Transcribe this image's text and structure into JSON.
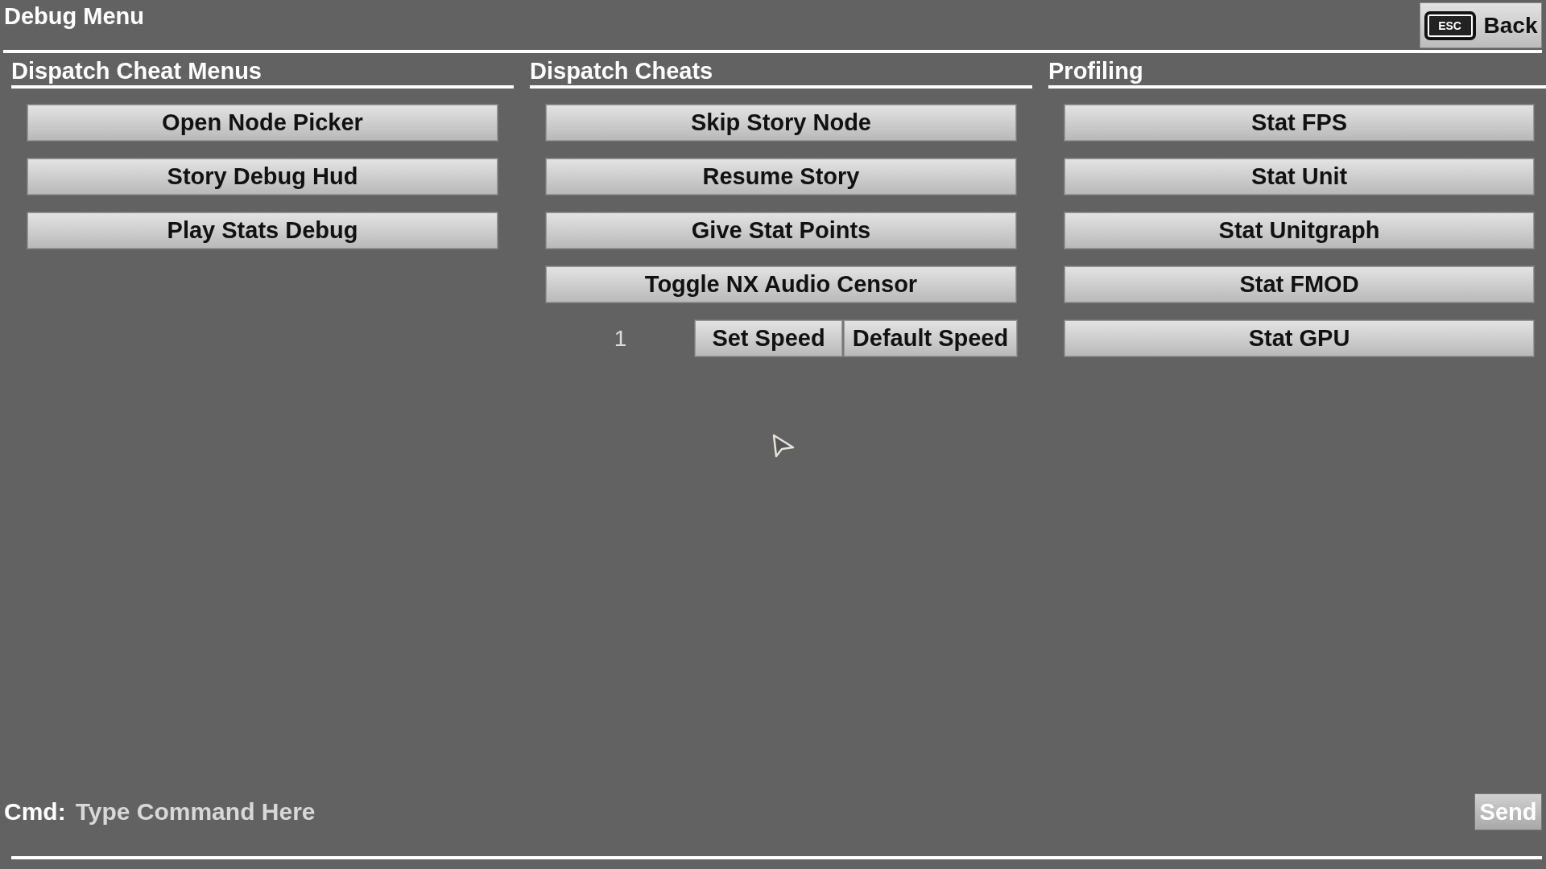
{
  "window": {
    "title": "Debug Menu"
  },
  "back_button": {
    "key": "ESC",
    "label": "Back"
  },
  "sections": [
    {
      "title": "Dispatch Cheat Menus",
      "buttons": [
        "Open Node Picker",
        "Story Debug Hud",
        "Play Stats Debug"
      ]
    },
    {
      "title": "Dispatch Cheats",
      "buttons": [
        "Skip Story Node",
        "Resume Story",
        "Give Stat Points",
        "Toggle NX Audio Censor"
      ],
      "speed_row": {
        "value": "1",
        "buttons": [
          "Set Speed",
          "Default Speed"
        ]
      }
    },
    {
      "title": "Profiling",
      "buttons": [
        "Stat FPS",
        "Stat Unit",
        "Stat Unitgraph",
        "Stat FMOD",
        "Stat GPU"
      ]
    }
  ],
  "command_bar": {
    "label": "Cmd:",
    "placeholder": "Type Command Here",
    "send_button": "Send"
  }
}
